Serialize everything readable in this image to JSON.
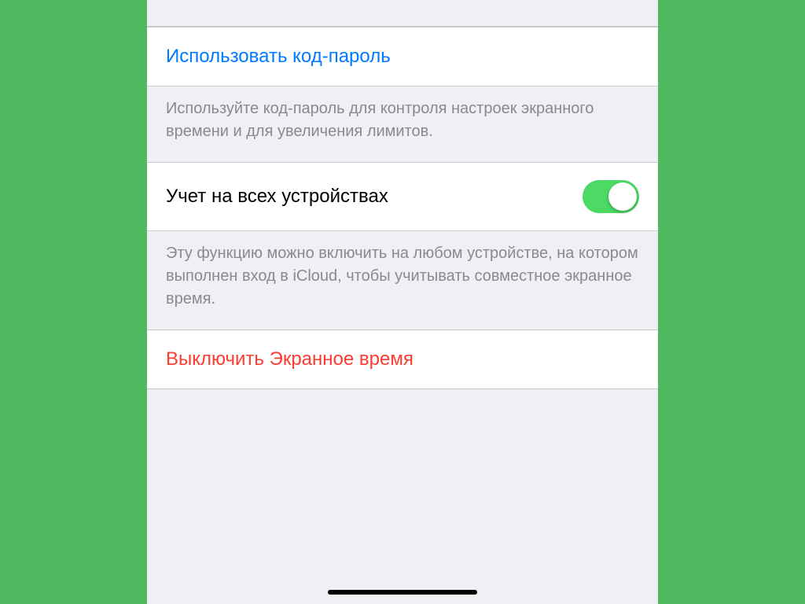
{
  "rows": {
    "usePasscode": {
      "label": "Использовать код-пароль"
    },
    "usePasscodeFooter": "Используйте код-пароль для контроля настроек экранного времени и для увеличения лимитов.",
    "shareAcrossDevices": {
      "label": "Учет на всех устройствах",
      "enabled": true
    },
    "shareAcrossDevicesFooter": "Эту функцию можно включить на любом устройстве, на котором выполнен вход в iCloud, чтобы учитывать совместное экранное время.",
    "turnOff": {
      "label": "Выключить Экранное время"
    }
  },
  "colors": {
    "linkBlue": "#007aff",
    "dangerRed": "#ff3b30",
    "toggleGreen": "#4cd964",
    "pageGreen": "#53b960",
    "groupGray": "#efeff4",
    "footerTextGray": "#8a8a8d"
  }
}
